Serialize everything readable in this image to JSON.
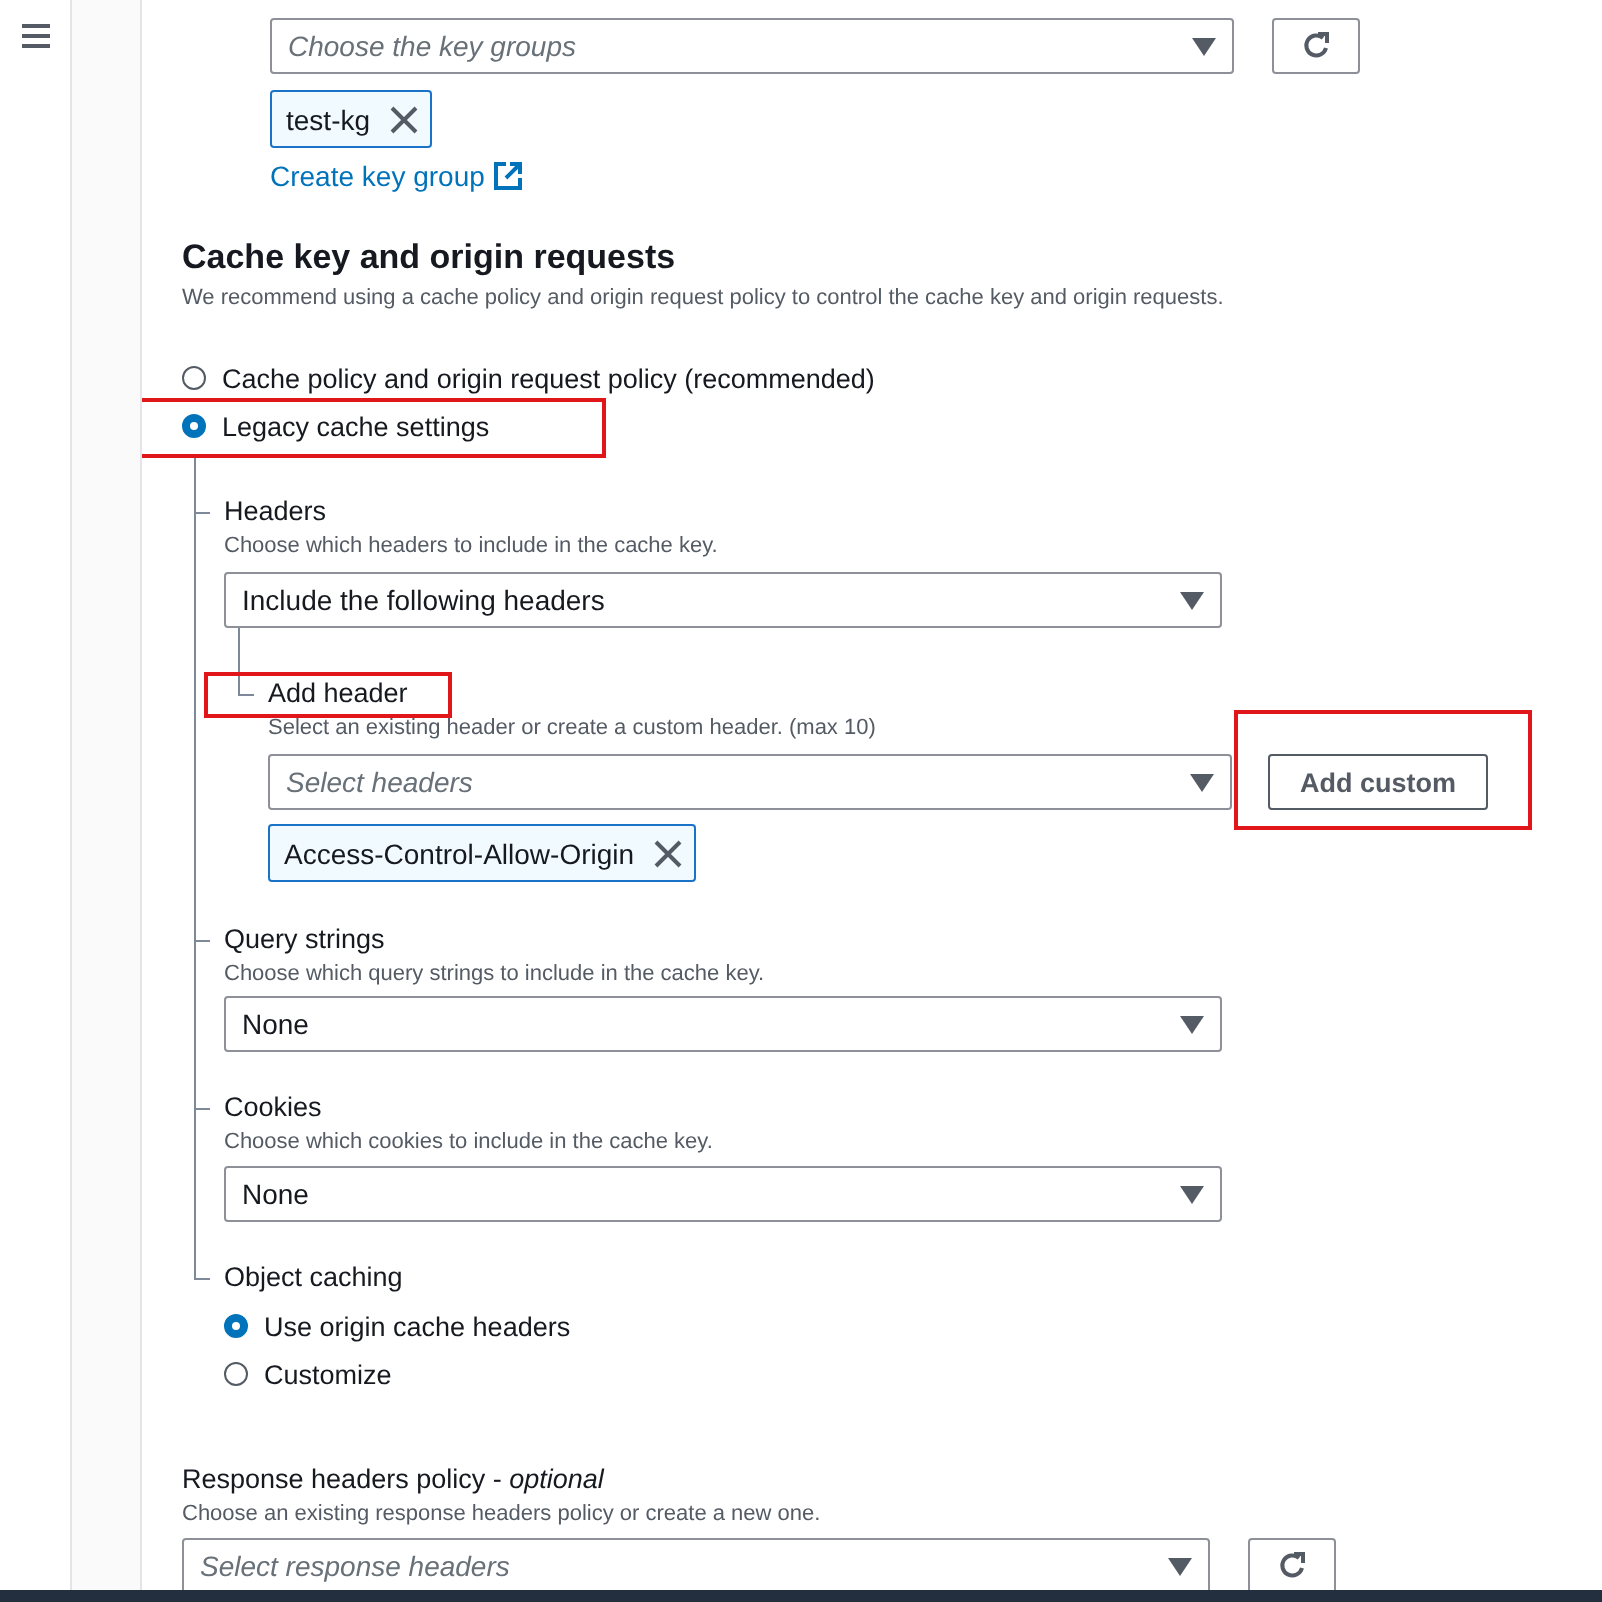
{
  "key_groups": {
    "placeholder": "Choose the key groups",
    "tokens": [
      {
        "label": "test-kg"
      }
    ],
    "link": "Create key group"
  },
  "cache_section": {
    "title": "Cache key and origin requests",
    "description": "We recommend using a cache policy and origin request policy to control the cache key and origin requests.",
    "options": [
      {
        "label": "Cache policy and origin request policy (recommended)",
        "selected": false
      },
      {
        "label": "Legacy cache settings",
        "selected": true,
        "highlighted": true
      }
    ]
  },
  "legacy": {
    "headers": {
      "label": "Headers",
      "description": "Choose which headers to include in the cache key.",
      "value": "Include the following headers",
      "add_header": {
        "label": "Add header",
        "highlighted": true,
        "description": "Select an existing header or create a custom header. (max 10)",
        "placeholder": "Select headers",
        "button": {
          "label": "Add custom",
          "highlighted": true
        },
        "tokens": [
          {
            "label": "Access-Control-Allow-Origin"
          }
        ]
      }
    },
    "query_strings": {
      "label": "Query strings",
      "description": "Choose which query strings to include in the cache key.",
      "value": "None"
    },
    "cookies": {
      "label": "Cookies",
      "description": "Choose which cookies to include in the cache key.",
      "value": "None"
    },
    "object_caching": {
      "label": "Object caching",
      "options": [
        {
          "label": "Use origin cache headers",
          "selected": true
        },
        {
          "label": "Customize",
          "selected": false
        }
      ]
    }
  },
  "response_headers": {
    "label": "Response headers policy - *optional*",
    "description": "Choose an existing response headers policy or create a new one.",
    "placeholder": "Select response headers"
  }
}
